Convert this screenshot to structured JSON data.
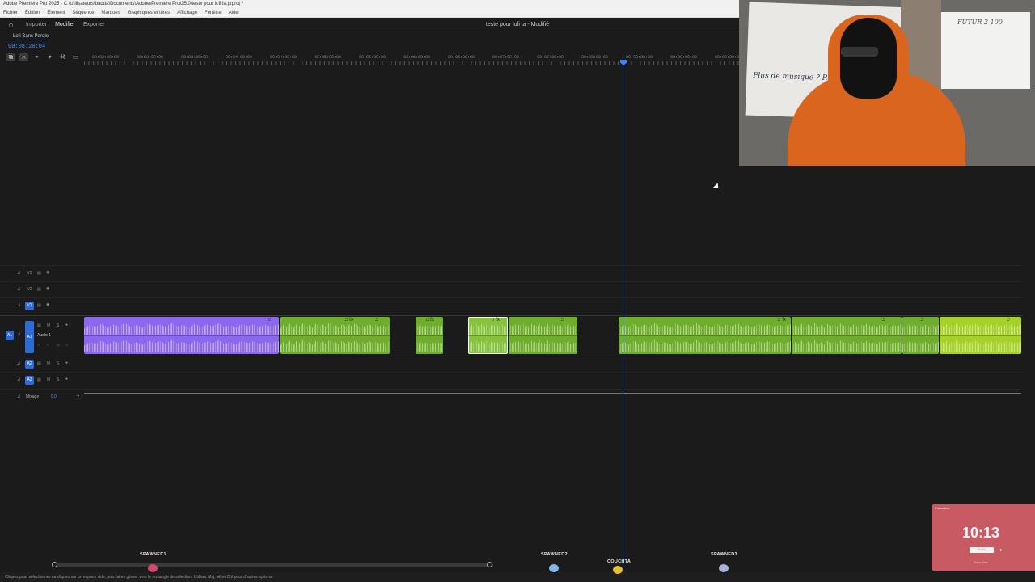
{
  "titlebar": {
    "title": "Adobe Premiere Pro 2025 - C:\\Utilisateurs\\badda\\Documents\\Adobe\\Premiere Pro\\25.0\\teste pour lofi la.prproj *"
  },
  "menu": [
    "Fichier",
    "Édition",
    "Élément",
    "Séquence",
    "Marques",
    "Graphiques et titres",
    "Affichage",
    "Fenêtre",
    "Aide"
  ],
  "workspace": {
    "tabs": [
      {
        "label": "Importer",
        "active": false
      },
      {
        "label": "Modifier",
        "active": true
      },
      {
        "label": "Exporter",
        "active": false
      }
    ],
    "document_title": "teste pour lofi la - Modifié"
  },
  "timeline": {
    "sequence_name": "Lofi Sans Parole",
    "current_timecode": "00:08:20:04",
    "ruler_ticks": [
      "00:02:30:00",
      "00:03:00:00",
      "00:03:30:00",
      "00:04:00:00",
      "00:04:30:00",
      "00:05:00:00",
      "00:05:30:00",
      "00:06:00:00",
      "00:06:30:00",
      "00:07:00:00",
      "00:07:30:00",
      "00:08:00:00",
      "00:08:30:00",
      "00:09:00:00",
      "00:09:30:00"
    ],
    "video_tracks": [
      "V3",
      "V2",
      "V1"
    ],
    "audio_tracks": [
      "A1",
      "A2",
      "A3"
    ],
    "audio1_name": "Audio 1",
    "source_patch": "A1",
    "mix_label": "Mixage",
    "mix_value": "0,0",
    "clip_colors": {
      "purple": "#8c67ef",
      "green": "#6fae2c",
      "lime": "#a6d129",
      "playhead": "#4d8fff"
    }
  },
  "status": "Cliquez pour sélectionner ou cliquez sur un espace vide, puis faites glisser vers le rectangle de sélection. Utilisez Maj, Alt et Ctrl pour d'autres options.",
  "overlays": {
    "spawns": [
      "SPAWNED1",
      "SPAWNED2",
      "COUCHTA",
      "SPAWNED3"
    ],
    "webcam_board_text": "Plus de musique ? Réclamations pardon",
    "webcam_board2_text": "FUTUR 2 100"
  },
  "timer": {
    "header": "Pomodoro",
    "time": "10:13",
    "button": "PAUSE",
    "footer": "Focus time"
  }
}
